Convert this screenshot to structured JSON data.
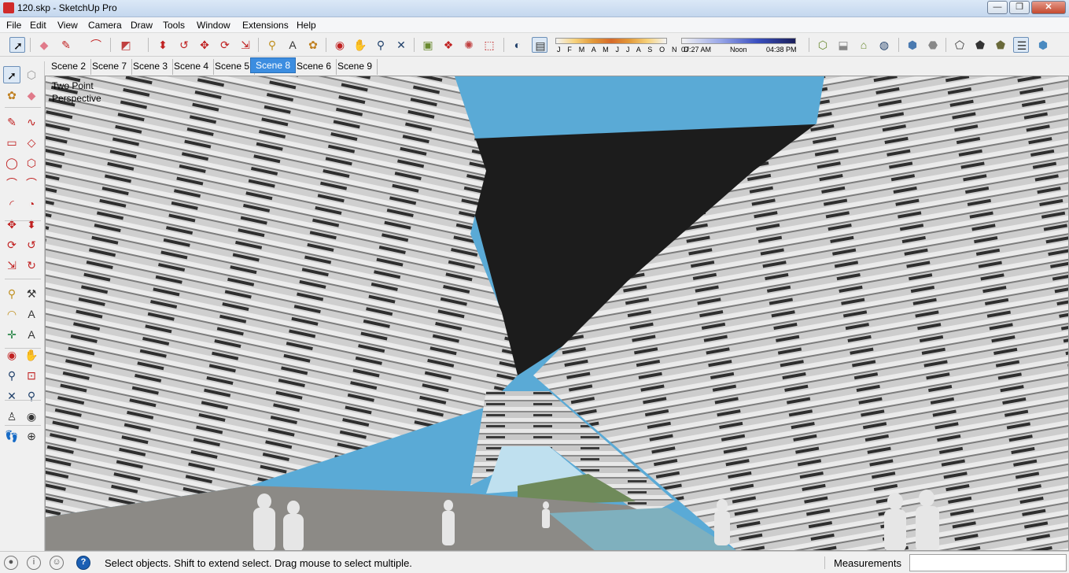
{
  "window": {
    "title": "120.skp - SketchUp Pro",
    "minimize": "—",
    "maximize": "❐",
    "close": "✕"
  },
  "menu": [
    "File",
    "Edit",
    "View",
    "Camera",
    "Draw",
    "Tools",
    "Window",
    "Extensions",
    "Help"
  ],
  "toolbar": {
    "icons": [
      {
        "name": "select-icon",
        "glyph": "➚",
        "color": "#000000",
        "active": true
      },
      {
        "name": "eraser-icon",
        "glyph": "◆",
        "color": "#e07a8a"
      },
      {
        "name": "pencil-icon",
        "glyph": "✎",
        "color": "#c02020"
      },
      {
        "name": "arc-icon",
        "glyph": "⌒",
        "color": "#c02020"
      },
      {
        "name": "rectangle-icon",
        "glyph": "◩",
        "color": "#c04040"
      },
      {
        "name": "push-pull-icon",
        "glyph": "⬍",
        "color": "#c02020"
      },
      {
        "name": "follow-me-icon",
        "glyph": "↺",
        "color": "#c02020"
      },
      {
        "name": "move-icon",
        "glyph": "✥",
        "color": "#c02020"
      },
      {
        "name": "rotate-icon",
        "glyph": "⟳",
        "color": "#c02020"
      },
      {
        "name": "scale-icon",
        "glyph": "⇲",
        "color": "#c02020"
      },
      {
        "name": "tape-measure-icon",
        "glyph": "⚲",
        "color": "#c09020"
      },
      {
        "name": "text-icon",
        "glyph": "A",
        "color": "#333333"
      },
      {
        "name": "paint-bucket-icon",
        "glyph": "✿",
        "color": "#c08020"
      },
      {
        "name": "orbit-icon",
        "glyph": "◉",
        "color": "#c02020"
      },
      {
        "name": "pan-icon",
        "glyph": "✋",
        "color": "#666666"
      },
      {
        "name": "zoom-icon",
        "glyph": "⚲",
        "color": "#20406a"
      },
      {
        "name": "zoom-extents-icon",
        "glyph": "✕",
        "color": "#20406a"
      },
      {
        "name": "warehouse-icon",
        "glyph": "▣",
        "color": "#6a8a30"
      },
      {
        "name": "components-icon",
        "glyph": "❖",
        "color": "#c02020"
      },
      {
        "name": "extension-warehouse-icon",
        "glyph": "✺",
        "color": "#c04040"
      },
      {
        "name": "layout-icon",
        "glyph": "⬚",
        "color": "#c02020"
      },
      {
        "name": "shadows-icon",
        "glyph": "◐",
        "color": "#20406a"
      },
      {
        "name": "fog-icon",
        "glyph": "▤",
        "color": "#333333",
        "active": true
      },
      {
        "name": "views-iso-icon",
        "glyph": "⬡",
        "color": "#6a8a30"
      },
      {
        "name": "views-top-icon",
        "glyph": "⬓",
        "color": "#888888"
      },
      {
        "name": "views-front-icon",
        "glyph": "⌂",
        "color": "#6a8a30"
      },
      {
        "name": "views-right-icon",
        "glyph": "◍",
        "color": "#20406a"
      },
      {
        "name": "style-xray-icon",
        "glyph": "⬢",
        "color": "#4a7ab0"
      },
      {
        "name": "style-back-edges-icon",
        "glyph": "⬣",
        "color": "#888888"
      },
      {
        "name": "style-wireframe-icon",
        "glyph": "⬠",
        "color": "#333333"
      },
      {
        "name": "style-hidden-line-icon",
        "glyph": "⬟",
        "color": "#333333"
      },
      {
        "name": "style-shaded-icon",
        "glyph": "⬟",
        "color": "#6a6a3a"
      },
      {
        "name": "style-textured-icon",
        "glyph": "☰",
        "color": "#333333",
        "active": true
      },
      {
        "name": "style-monochrome-icon",
        "glyph": "⬢",
        "color": "#4a8ac0"
      }
    ]
  },
  "shadow": {
    "months": "J F M A M J J A S O N D",
    "time_start": "07:27 AM",
    "time_mid": "Noon",
    "time_end": "04:38 PM"
  },
  "scenes": {
    "tabs": [
      "Scene 2",
      "Scene 7",
      "Scene 3",
      "Scene 4",
      "Scene 5",
      "Scene 8",
      "Scene 6",
      "Scene 9"
    ],
    "selected": "Scene 8"
  },
  "left_tools": [
    {
      "name": "select-tool-icon",
      "glyph": "➚",
      "color": "#000000",
      "active": true
    },
    {
      "name": "make-component-icon",
      "glyph": "⬡",
      "color": "#999999"
    },
    {
      "name": "paint-bucket-tool-icon",
      "glyph": "✿",
      "color": "#c08020"
    },
    {
      "name": "eraser-tool-icon",
      "glyph": "◆",
      "color": "#e07a8a"
    },
    {
      "name": "line-tool-icon",
      "glyph": "✎",
      "color": "#c02020"
    },
    {
      "name": "freehand-tool-icon",
      "glyph": "∿",
      "color": "#c02020"
    },
    {
      "name": "rectangle-tool-icon",
      "glyph": "▭",
      "color": "#c02020"
    },
    {
      "name": "rotated-rectangle-icon",
      "glyph": "◇",
      "color": "#c02020"
    },
    {
      "name": "circle-tool-icon",
      "glyph": "◯",
      "color": "#c02020"
    },
    {
      "name": "polygon-tool-icon",
      "glyph": "⬡",
      "color": "#c02020"
    },
    {
      "name": "arc-tool-icon",
      "glyph": "⌒",
      "color": "#c02020"
    },
    {
      "name": "two-point-arc-icon",
      "glyph": "⌒",
      "color": "#c02020"
    },
    {
      "name": "three-point-arc-icon",
      "glyph": "◜",
      "color": "#c02020"
    },
    {
      "name": "pie-tool-icon",
      "glyph": "◔",
      "color": "#c02020"
    },
    {
      "name": "move-tool-icon",
      "glyph": "✥",
      "color": "#c02020"
    },
    {
      "name": "push-pull-tool-icon",
      "glyph": "⬍",
      "color": "#c02020"
    },
    {
      "name": "rotate-tool-icon",
      "glyph": "⟳",
      "color": "#c02020"
    },
    {
      "name": "follow-me-tool-icon",
      "glyph": "↺",
      "color": "#c02020"
    },
    {
      "name": "scale-tool-icon",
      "glyph": "⇲",
      "color": "#c02020"
    },
    {
      "name": "offset-tool-icon",
      "glyph": "↻",
      "color": "#c02020"
    },
    {
      "name": "tape-measure-tool-icon",
      "glyph": "⚲",
      "color": "#c09020"
    },
    {
      "name": "dimension-tool-icon",
      "glyph": "⚒",
      "color": "#333333"
    },
    {
      "name": "protractor-tool-icon",
      "glyph": "◠",
      "color": "#c09020"
    },
    {
      "name": "text-tool-icon",
      "glyph": "A",
      "color": "#333333"
    },
    {
      "name": "axes-tool-icon",
      "glyph": "✛",
      "color": "#208040"
    },
    {
      "name": "3d-text-tool-icon",
      "glyph": "A",
      "color": "#333333"
    },
    {
      "name": "orbit-tool-icon",
      "glyph": "◉",
      "color": "#c02020"
    },
    {
      "name": "pan-tool-icon",
      "glyph": "✋",
      "color": "#666666"
    },
    {
      "name": "zoom-tool-icon",
      "glyph": "⚲",
      "color": "#20406a"
    },
    {
      "name": "zoom-window-tool-icon",
      "glyph": "⊡",
      "color": "#c02020"
    },
    {
      "name": "zoom-extents-tool-icon",
      "glyph": "✕",
      "color": "#20406a"
    },
    {
      "name": "previous-view-icon",
      "glyph": "⚲",
      "color": "#20406a"
    },
    {
      "name": "position-camera-icon",
      "glyph": "♙",
      "color": "#333333"
    },
    {
      "name": "look-around-icon",
      "glyph": "◉",
      "color": "#333333"
    },
    {
      "name": "walk-tool-icon",
      "glyph": "👣",
      "color": "#333333"
    },
    {
      "name": "section-plane-icon",
      "glyph": "⊕",
      "color": "#333333"
    }
  ],
  "viewport": {
    "camera_label": "Two Point Perspective",
    "colors": {
      "sky": "#5aaad6",
      "dark_void": "#1c1c1c",
      "facade": "#bdbdbd",
      "ground": "#8c8a86",
      "water": "#7fb0be"
    }
  },
  "statusbar": {
    "icons": [
      "geo-location-icon",
      "credits-icon",
      "user-account-icon"
    ],
    "help_glyph": "?",
    "message": "Select objects. Shift to extend select. Drag mouse to select multiple.",
    "measurements_label": "Measurements",
    "measurements_value": ""
  }
}
